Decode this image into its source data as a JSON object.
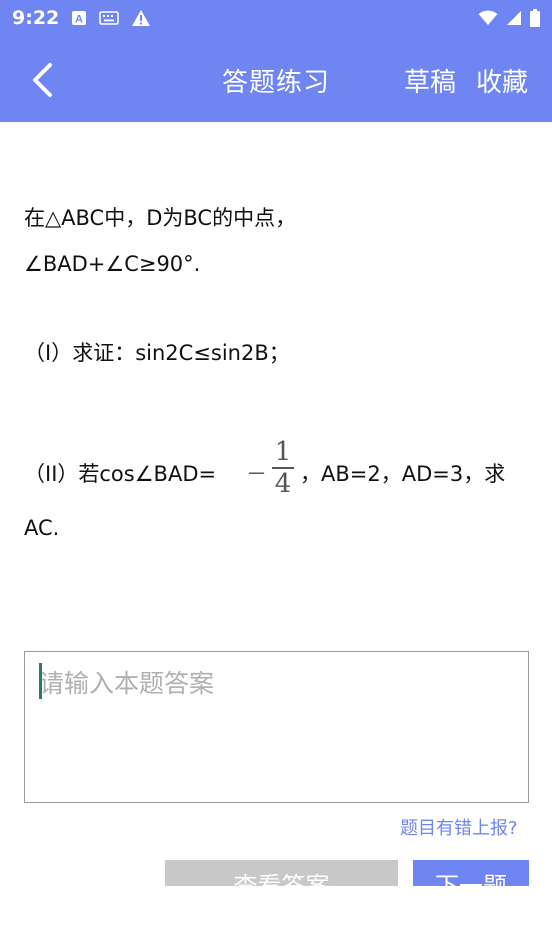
{
  "status_bar": {
    "time": "9:22",
    "icons_left": [
      "a-notification-icon",
      "keyboard-icon",
      "warning-icon"
    ],
    "icons_right": [
      "wifi-icon",
      "signal-icon",
      "battery-icon"
    ]
  },
  "app_bar": {
    "title": "答题练习",
    "draft_label": "草稿",
    "favorite_label": "收藏"
  },
  "question": {
    "line1": "在△ABC中，D为BC的中点，",
    "line2": "∠BAD+∠C≥90°.",
    "part1": "（I）求证：sin2C≤sin2B；",
    "part2_before": "（II）若cos∠BAD=",
    "part2_sign": "－",
    "part2_frac_num": "1",
    "part2_frac_den": "4",
    "part2_after": "，AB=2，AD=3，求",
    "part2_line2": "AC."
  },
  "answer": {
    "placeholder": "请输入本题答案",
    "value": ""
  },
  "report_link": "题目有错上报?",
  "buttons": {
    "view_answer": "查看答案",
    "next": "下一题"
  },
  "colors": {
    "primary": "#6f86f2",
    "disabled_button": "#c8c8c8",
    "caret": "#2a7a6c"
  }
}
